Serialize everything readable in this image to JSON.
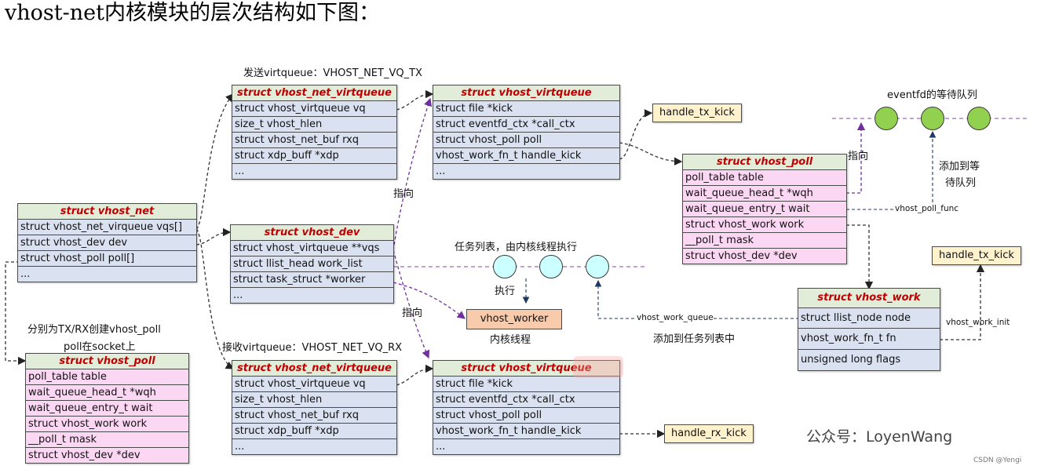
{
  "heading": "vhost-net内核模块的层次结构如下图：",
  "structs": {
    "vhost_net": {
      "title": "struct vhost_net",
      "fields": [
        "struct vhost_net_virqueue vqs[]",
        "struct vhost_dev dev",
        "struct vhost_poll poll[]",
        "..."
      ]
    },
    "vhost_dev": {
      "title": "struct vhost_dev",
      "fields": [
        "struct vhost_virtqueue **vqs",
        "struct llist_head work_list",
        "struct task_struct *worker",
        "..."
      ]
    },
    "net_vq_tx": {
      "title": "struct vhost_net_virtqueue",
      "fields": [
        "struct vhost_virtqueue vq",
        "size_t vhost_hlen",
        "struct vhost_net_buf rxq",
        "struct xdp_buff *xdp",
        "..."
      ]
    },
    "vq_tx": {
      "title": "struct vhost_virtqueue",
      "fields": [
        "struct file *kick",
        "struct eventfd_ctx *call_ctx",
        "struct vhost_poll poll",
        "vhost_work_fn_t handle_kick",
        "..."
      ]
    },
    "net_vq_rx": {
      "title": "struct vhost_net_virtqueue",
      "fields": [
        "struct vhost_virtqueue vq",
        "size_t vhost_hlen",
        "struct vhost_net_buf rxq",
        "struct xdp_buff *xdp",
        "..."
      ]
    },
    "vq_rx": {
      "title": "struct vhost_virtqueue",
      "fields": [
        "struct file *kick",
        "struct eventfd_ctx *call_ctx",
        "struct vhost_poll poll",
        "vhost_work_fn_t handle_kick",
        "..."
      ]
    },
    "poll_top": {
      "title": "struct vhost_poll",
      "fields": [
        "poll_table table",
        "wait_queue_head_t *wqh",
        "wait_queue_entry_t wait",
        "struct vhost_work work",
        "__poll_t mask",
        "struct vhost_dev *dev"
      ]
    },
    "poll_left": {
      "title": "struct vhost_poll",
      "fields": [
        "poll_table table",
        "wait_queue_head_t *wqh",
        "wait_queue_entry_t wait",
        "struct vhost_work work",
        "__poll_t mask",
        "struct vhost_dev *dev"
      ]
    },
    "vhost_work": {
      "title": "struct vhost_work",
      "fields": [
        "struct llist_node node",
        "vhost_work_fn_t fn",
        "unsigned long flags"
      ]
    }
  },
  "functions": {
    "tx_kick_top": "handle_tx_kick",
    "tx_kick_right": "handle_tx_kick",
    "rx_kick": "handle_rx_kick",
    "worker": "vhost_worker"
  },
  "labels": {
    "tx_queue": "发送virtqueue：VHOST_NET_VQ_TX",
    "rx_queue": "接收virtqueue：VHOST_NET_VQ_RX",
    "points_to_1": "指向",
    "points_to_2": "指向",
    "points_to_3": "指向",
    "eventfd_wait_queue": "eventfd的等待队列",
    "add_to_wait_queue_1": "添加到等",
    "add_to_wait_queue_2": "待队列",
    "vhost_poll_func": "vhost_poll_func",
    "task_list": "任务列表，由内核线程执行",
    "execute": "执行",
    "kernel_thread": "内核线程",
    "vhost_work_queue": "vhost_work_queue",
    "add_to_task_list": "添加到任务列表中",
    "vhost_work_init": "vhost_work_init",
    "poll_note_1": "分别为TX/RX创建vhost_poll",
    "poll_note_2": "poll在socket上",
    "watermark": "公众号：LoyenWang",
    "csdn": "CSDN @Yengi"
  },
  "colors": {
    "header_bg": "#e2edd9",
    "title_red": "#c00000",
    "field_blue": "#dae1f0",
    "field_pink": "#fcd7f3",
    "func_yellow": "#fff2cc",
    "worker_orange": "#f8cbad",
    "node_green": "#92d050",
    "node_cyan": "#ccffff",
    "purple_link": "#7030a0",
    "navy_link": "#1f3864"
  }
}
